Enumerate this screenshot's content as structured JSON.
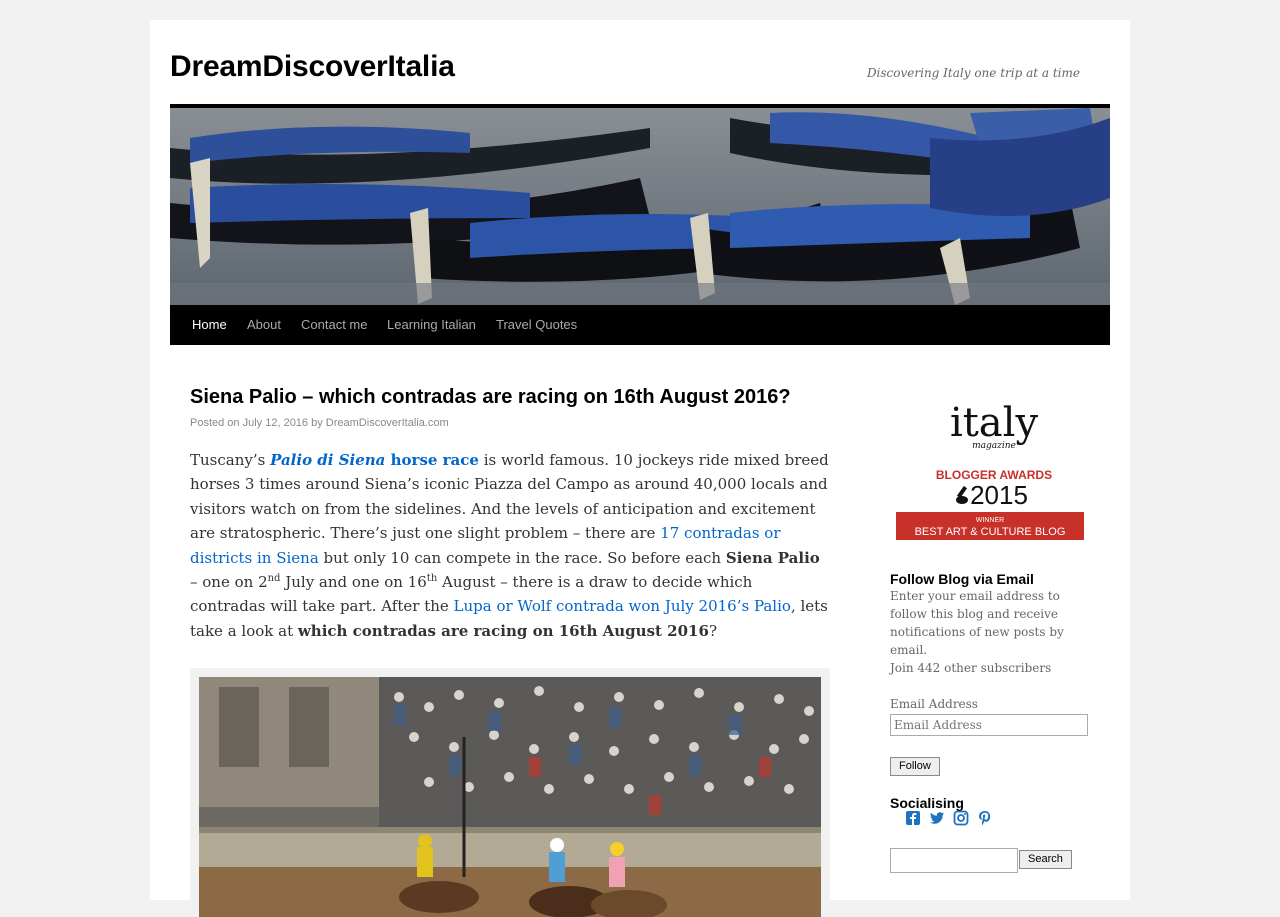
{
  "site": {
    "title": "DreamDiscoverItalia",
    "description": "Discovering Italy one trip at a time"
  },
  "nav": {
    "items": [
      "Home",
      "About",
      "Contact me",
      "Learning Italian",
      "Travel Quotes"
    ],
    "current": "Home"
  },
  "post": {
    "title": "Siena Palio – which contradas are racing on 16th August 2016?",
    "meta": {
      "posted_on": "Posted on",
      "date": "July 12, 2016",
      "by": "by",
      "author": "DreamDiscoverItalia.com"
    },
    "body": {
      "p1": "Tuscany’s ",
      "link_palio_italic": "Palio di Siena",
      "link_palio_rest": " horse race",
      "p2": " is world famous. 10 jockeys ride mixed breed horses 3 times around Siena’s iconic Piazza del Campo as around 40,000 locals and visitors watch on from the sidelines. And the levels of anticipation and excitement are stratospheric. There’s just one slight problem – there are ",
      "link_contradas": "17 contradas or districts in Siena",
      "p3": " but only 10 can compete in the race. So before each ",
      "bold_siena_palio": "Siena Palio",
      "p4": " – one on 2",
      "sup_nd": "nd",
      "p5": " July and one on 16",
      "sup_th": "th",
      "p6": " August – there is a draw to decide which contradas will take part. After the ",
      "link_lupa": "Lupa or Wolf contrada won July 2016’s Palio",
      "p7": ", lets take a look at ",
      "bold_question": "which contradas are racing on 16th August 2016",
      "p8": "?"
    }
  },
  "sidebar": {
    "award": {
      "logo_word": "italy",
      "logo_sub": "magazine",
      "line1": "BLOGGER AWARDS",
      "year": "2015",
      "winner": "WINNER",
      "category": "BEST ART & CULTURE BLOG"
    },
    "follow": {
      "title": "Follow Blog via Email",
      "text": "Enter your email address to follow this blog and receive notifications of new posts by email.",
      "subscribers": "Join 442 other subscribers",
      "email_label": "Email Address",
      "email_placeholder": "Email Address",
      "button": "Follow"
    },
    "social": {
      "title": "Socialising",
      "icons": [
        "facebook-icon",
        "twitter-icon",
        "instagram-icon",
        "pinterest-icon"
      ],
      "color": "#1e73be"
    },
    "search": {
      "button": "Search"
    }
  }
}
